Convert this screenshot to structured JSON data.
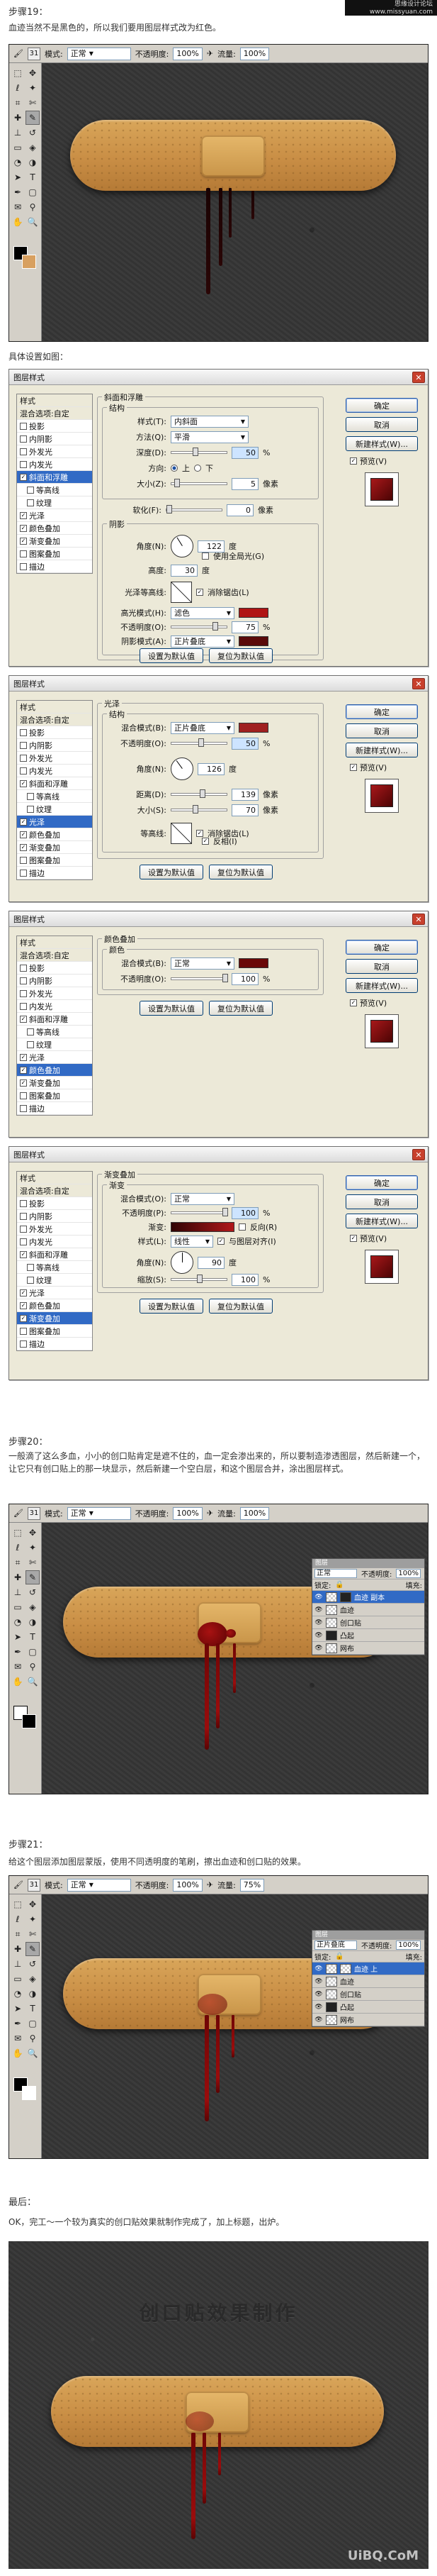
{
  "watermark_top": "思缘设计论坛\nwww.missyuan.com",
  "step19": {
    "title": "步骤19：",
    "desc": "血迹当然不是黑色的，所以我们要用图层样式改为红色。"
  },
  "ps_optbar": {
    "brush_size": "31",
    "mode_label": "模式:",
    "mode_value": "正常",
    "opacity_label": "不透明度:",
    "opacity_value": "100%",
    "flow_label": "流量:",
    "flow_value": "100%"
  },
  "settings_text": "具体设置如图：",
  "dialog_common": {
    "title": "图层样式",
    "close": "✕",
    "styles_header": "样式",
    "blend_options": "混合选项:自定",
    "ok": "确定",
    "cancel": "取消",
    "new_style": "新建样式(W)...",
    "preview_label": "预览(V)",
    "set_default": "设置为默认值",
    "reset_default": "复位为默认值"
  },
  "style_items": [
    "投影",
    "内阴影",
    "外发光",
    "内发光",
    "斜面和浮雕",
    "等高线",
    "纹理",
    "光泽",
    "颜色叠加",
    "渐变叠加",
    "图案叠加",
    "描边"
  ],
  "dialog1": {
    "section": "斜面和浮雕",
    "struct": "结构",
    "style_label": "样式(T):",
    "style_value": "内斜面",
    "method_label": "方法(Q):",
    "method_value": "平滑",
    "depth_label": "深度(D):",
    "depth_value": "50",
    "depth_unit": "%",
    "dir_label": "方向:",
    "dir_up": "上",
    "dir_down": "下",
    "size_label": "大小(Z):",
    "size_value": "5",
    "size_unit": "像素",
    "soften_label": "软化(F):",
    "soften_value": "0",
    "soften_unit": "像素",
    "shading": "阴影",
    "angle_label": "角度(N):",
    "angle_value": "122",
    "angle_unit": "度",
    "global_light": "使用全局光(G)",
    "altitude_label": "高度:",
    "altitude_value": "30",
    "altitude_unit": "度",
    "gloss_label": "光泽等高线:",
    "antialias": "消除锯齿(L)",
    "hl_mode_label": "高光模式(H):",
    "hl_mode_value": "滤色",
    "hl_op_label": "不透明度(O):",
    "hl_op_value": "75",
    "hl_op_unit": "%",
    "sh_mode_label": "阴影模式(A):",
    "sh_mode_value": "正片叠底",
    "sh_op_label": "不透明度(C):",
    "sh_op_value": "75",
    "sh_op_unit": "%",
    "hl_color": "#b01414",
    "sh_color": "#5a0a0a"
  },
  "dialog2": {
    "section": "光泽",
    "struct": "结构",
    "mode_label": "混合模式(B):",
    "mode_value": "正片叠底",
    "op_label": "不透明度(O):",
    "op_value": "50",
    "op_unit": "%",
    "angle_label": "角度(N):",
    "angle_value": "126",
    "angle_unit": "度",
    "distance_label": "距离(D):",
    "distance_value": "139",
    "distance_unit": "像素",
    "size_label": "大小(S):",
    "size_value": "70",
    "size_unit": "像素",
    "contour_label": "等高线:",
    "antialias": "消除锯齿(L)",
    "invert": "反相(I)",
    "chip_color": "#a02020"
  },
  "dialog3": {
    "section": "颜色叠加",
    "sub": "颜色",
    "mode_label": "混合模式(B):",
    "mode_value": "正常",
    "op_label": "不透明度(O):",
    "op_value": "100",
    "op_unit": "%",
    "chip_color": "#6a0808"
  },
  "dialog4": {
    "section": "渐变叠加",
    "sub": "渐变",
    "mode_label": "混合模式(O):",
    "mode_value": "正常",
    "op_label": "不透明度(P):",
    "op_value": "100",
    "op_unit": "%",
    "grad_label": "渐变:",
    "reverse": "反向(R)",
    "style_label": "样式(L):",
    "style_value": "线性",
    "align": "与图层对齐(I)",
    "angle_label": "角度(N):",
    "angle_value": "90",
    "angle_unit": "度",
    "scale_label": "缩放(S):",
    "scale_value": "100",
    "scale_unit": "%"
  },
  "step20": {
    "title": "步骤20：",
    "desc": "一般滴了这么多血，小小的创口贴肯定是遮不住的，血一定会渗出来的，所以要制造渗透图层，然后新建一个，让它只有创口贴上的那一块显示，然后新建一个空白层，和这个图层合并，涂出图层样式。"
  },
  "layers1": {
    "head": "图层",
    "mode_value": "正常",
    "op_label": "不透明度:",
    "op_value": "100%",
    "lock_label": "锁定:",
    "fill_label": "填充:",
    "rows": [
      "血迹 副本",
      "血迹",
      "创口贴",
      "凸起",
      "网布"
    ]
  },
  "step21": {
    "title": "步骤21：",
    "desc": "给这个图层添加图层蒙版，使用不同透明度的笔刷，擦出血迹和创口贴的效果。"
  },
  "ps_optbar2": {
    "opacity_value": "100%",
    "flow_value": "75%"
  },
  "layers2": {
    "mode_value": "正片叠底",
    "op_value": "100%",
    "rows": [
      "血迹 上",
      "血迹",
      "创口贴",
      "凸起",
      "网布"
    ]
  },
  "final": {
    "title": "最后：",
    "desc": "OK，完工～一个较为真实的创口贴效果就制作完成了，加上标题，出炉。",
    "image_title": "创口贴效果制作",
    "watermark": "UiBQ.CoM"
  }
}
